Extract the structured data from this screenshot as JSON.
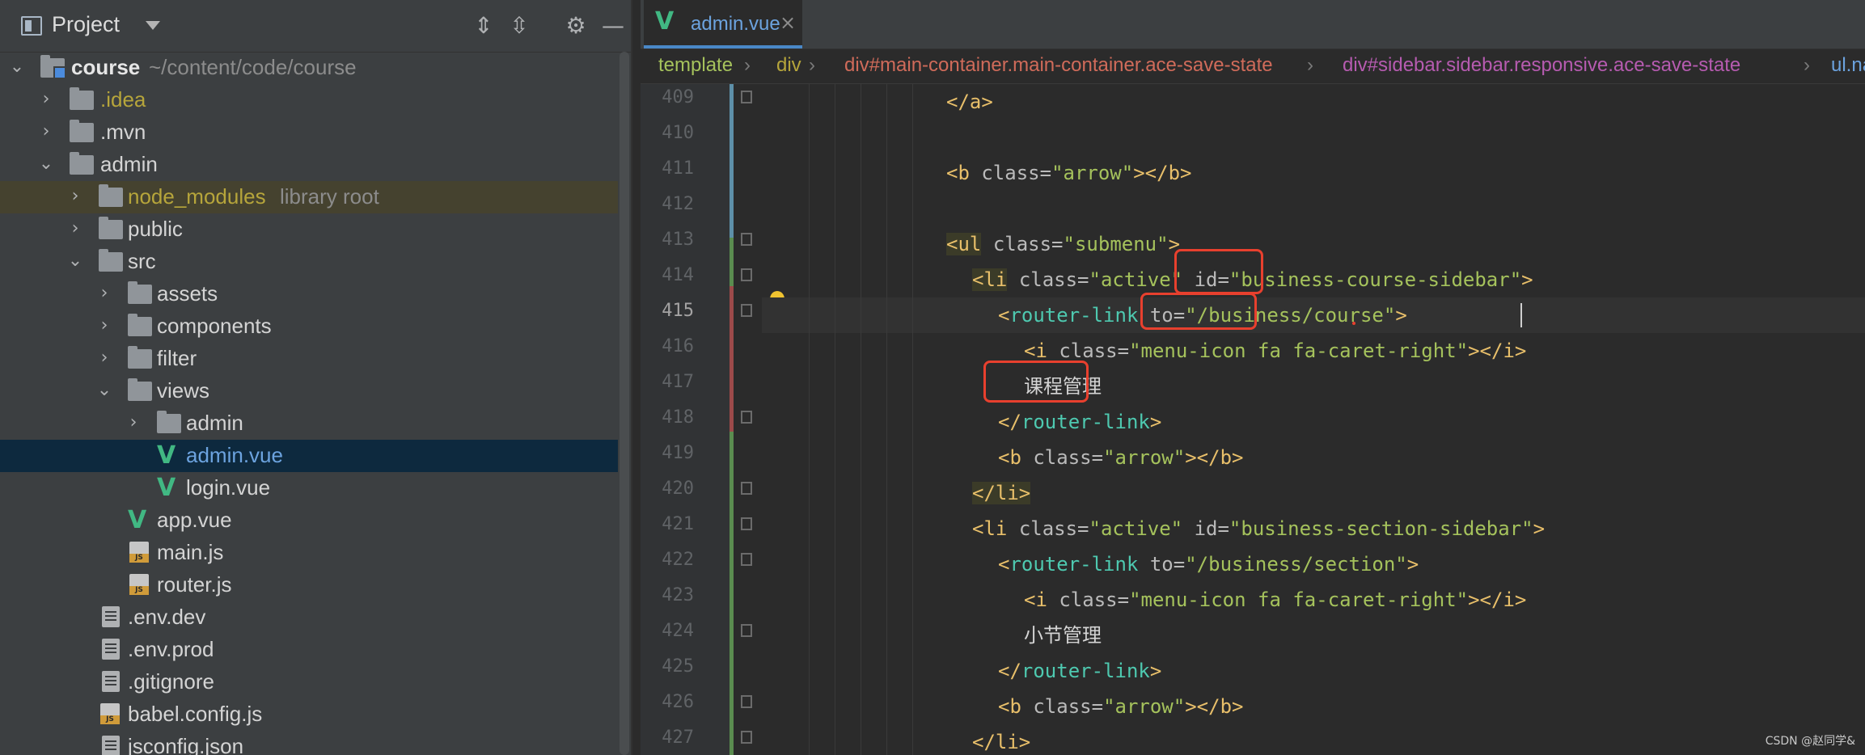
{
  "project_panel": {
    "title": "Project",
    "tree": [
      {
        "label": "course",
        "extra": "~/content/code/course",
        "depth": 0,
        "type": "root"
      },
      {
        "label": ".idea",
        "depth": 1,
        "type": "folder"
      },
      {
        "label": ".mvn",
        "depth": 1,
        "type": "folder"
      },
      {
        "label": "admin",
        "depth": 1,
        "type": "folder"
      },
      {
        "label": "node_modules",
        "extra": "library root",
        "depth": 2,
        "type": "folder"
      },
      {
        "label": "public",
        "depth": 2,
        "type": "folder"
      },
      {
        "label": "src",
        "depth": 2,
        "type": "folder"
      },
      {
        "label": "assets",
        "depth": 3,
        "type": "folder"
      },
      {
        "label": "components",
        "depth": 3,
        "type": "folder"
      },
      {
        "label": "filter",
        "depth": 3,
        "type": "folder"
      },
      {
        "label": "views",
        "depth": 3,
        "type": "folder"
      },
      {
        "label": "admin",
        "depth": 4,
        "type": "folder"
      },
      {
        "label": "admin.vue",
        "depth": 4,
        "type": "vue"
      },
      {
        "label": "login.vue",
        "depth": 4,
        "type": "vue"
      },
      {
        "label": "app.vue",
        "depth": 3,
        "type": "vue"
      },
      {
        "label": "main.js",
        "depth": 3,
        "type": "js"
      },
      {
        "label": "router.js",
        "depth": 3,
        "type": "js"
      },
      {
        "label": ".env.dev",
        "depth": 2,
        "type": "file"
      },
      {
        "label": ".env.prod",
        "depth": 2,
        "type": "file"
      },
      {
        "label": ".gitignore",
        "depth": 2,
        "type": "file"
      },
      {
        "label": "babel.config.js",
        "depth": 2,
        "type": "js"
      },
      {
        "label": "jsconfig.json",
        "depth": 2,
        "type": "file"
      }
    ]
  },
  "editor": {
    "tab": {
      "label": "admin.vue",
      "close": "×"
    },
    "breadcrumb": [
      "template",
      "div",
      "div#main-container.main-container.ace-save-state",
      "div#sidebar.sidebar.responsive.ace-save-state",
      "ul.nav.l"
    ],
    "lines": [
      {
        "n": "409"
      },
      {
        "n": "410"
      },
      {
        "n": "411"
      },
      {
        "n": "412"
      },
      {
        "n": "413"
      },
      {
        "n": "414"
      },
      {
        "n": "415"
      },
      {
        "n": "416"
      },
      {
        "n": "417"
      },
      {
        "n": "418"
      },
      {
        "n": "419"
      },
      {
        "n": "420"
      },
      {
        "n": "421"
      },
      {
        "n": "422"
      },
      {
        "n": "423"
      },
      {
        "n": "424"
      },
      {
        "n": "425"
      },
      {
        "n": "426"
      },
      {
        "n": "427"
      }
    ],
    "code": {
      "close_a": "</a>",
      "b_arrow_open": "<b ",
      "class_attr": "class=",
      "arrow_val": "\"arrow\"",
      "b_close": "></b>",
      "ul_open": "<ul",
      "submenu_val": "\"submenu\"",
      "gt": ">",
      "li_open": "<li",
      "active_val": "\"active\"",
      "id_attr": "id=",
      "course_sidebar_val": "\"business-course-sidebar\"",
      "section_sidebar_val": "\"business-section-sidebar\"",
      "lt": "<",
      "router_link": "router-link",
      "to_attr": "to=",
      "course_path_val": "\"/business/course\"",
      "section_path_val": "\"/business/section\"",
      "i_open": "<i ",
      "icon_val": "\"menu-icon fa fa-caret-right\"",
      "i_close": "></i>",
      "course_mgmt": "课程管理",
      "section_mgmt": "小节管理",
      "router_link_close_lt": "</",
      "li_close": "</li>"
    }
  },
  "watermark": "CSDN @赵同学&"
}
